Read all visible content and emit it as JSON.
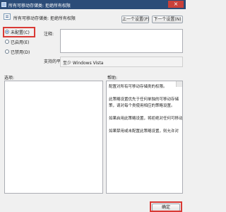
{
  "window": {
    "title": "所有可移动存储类: 拒绝所有权限"
  },
  "header": {
    "policy_title": "所有可移动存储类: 拒绝所有权限"
  },
  "nav": {
    "prev_label": "上一个设置(P)",
    "next_label": "下一个设置(N)"
  },
  "state": {
    "options": [
      {
        "label": "未配置(C)",
        "selected": true
      },
      {
        "label": "已启用(E)",
        "selected": false
      },
      {
        "label": "已禁用(D)",
        "selected": false
      }
    ]
  },
  "comment": {
    "label": "注释:",
    "value": ""
  },
  "platform": {
    "label": "支持的平台:",
    "value": "至少 Windows Vista"
  },
  "panels": {
    "options_label": "选项:",
    "help_label": "帮助:",
    "help_lines": [
      "配置对所有可移动存储类的权限。",
      "此策略设置优先于任何单独的可移动存储",
      "策，请对每个类使用相应的策略设置。",
      "如果启用此策略设置，将拒绝对任何可移动",
      "如果禁用或未配置此策略设置，则允许对"
    ]
  },
  "footer": {
    "ok_label": "确定"
  },
  "colors": {
    "highlight": "#d93a35",
    "titlebar": "#2b4c78"
  }
}
